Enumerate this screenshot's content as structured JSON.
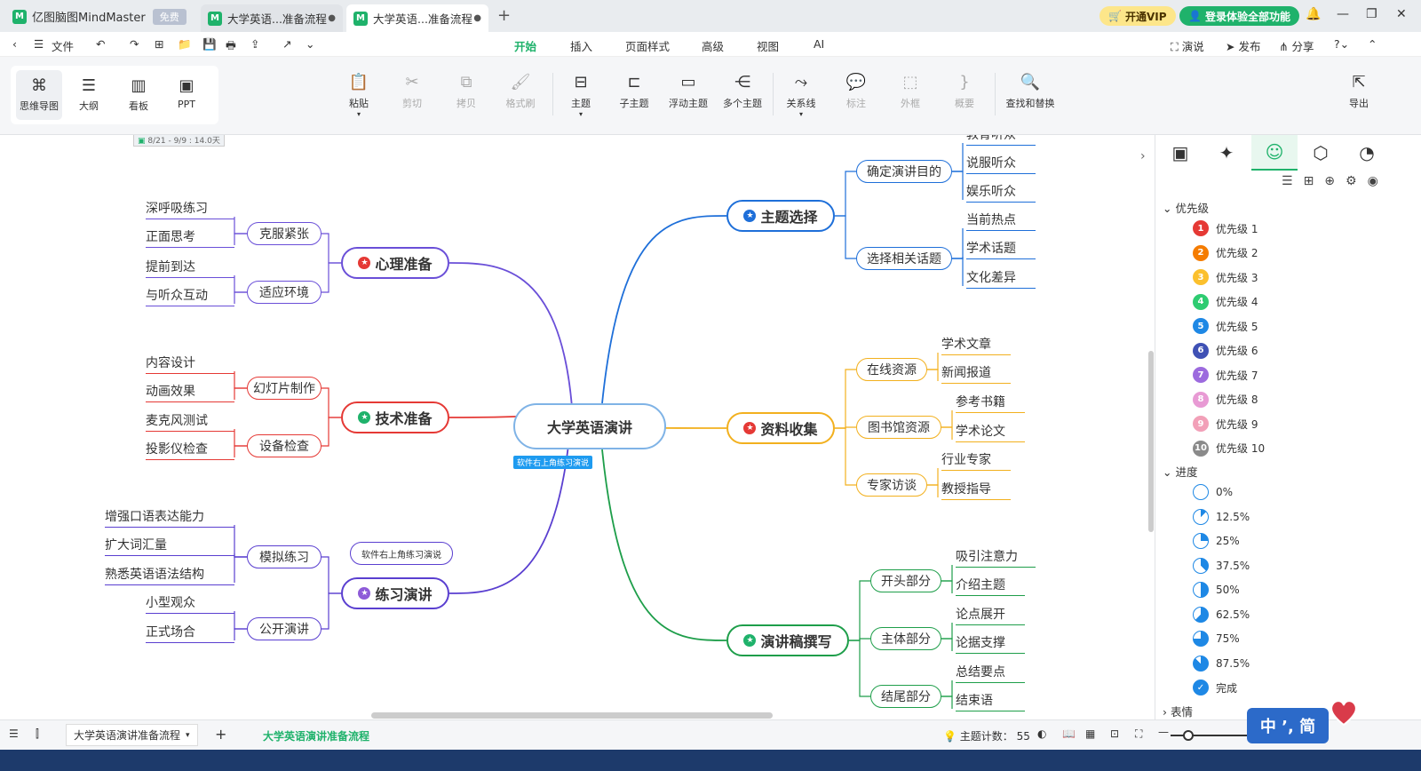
{
  "app": {
    "name": "亿图脑图MindMaster",
    "badge": "免费"
  },
  "tabs": [
    {
      "label": "大学英语...准备流程"
    },
    {
      "label": "大学英语...准备流程"
    }
  ],
  "titlebar": {
    "vip": "开通VIP",
    "login": "登录体验全部功能"
  },
  "menubar": {
    "file": "文件",
    "items": [
      "开始",
      "插入",
      "页面样式",
      "高级",
      "视图",
      "AI"
    ],
    "right": [
      "演说",
      "发布",
      "分享"
    ]
  },
  "views": [
    "思维导图",
    "大纲",
    "看板",
    "PPT"
  ],
  "ribbon": {
    "paste": "粘贴",
    "cut": "剪切",
    "copy": "拷贝",
    "format": "格式刷",
    "topic": "主题",
    "subtopic": "子主题",
    "float": "浮动主题",
    "multi": "多个主题",
    "relation": "关系线",
    "note": "标注",
    "outer": "外框",
    "summary": "概要",
    "find": "查找和替换",
    "export": "导出"
  },
  "mindmap": {
    "date_tag": "8/21 - 9/9 : 14.0天",
    "center": "大学英语演讲",
    "center_tip": "软件右上角练习演说",
    "practice_callout": "软件右上角练习演说",
    "left": [
      {
        "title": "心理准备",
        "color": "#6a4fd8",
        "mark": "#e53935",
        "subs": [
          {
            "title": "克服紧张",
            "leaves": [
              "深呼吸练习",
              "正面思考"
            ]
          },
          {
            "title": "适应环境",
            "leaves": [
              "提前到达",
              "与听众互动"
            ]
          }
        ]
      },
      {
        "title": "技术准备",
        "color": "#e53935",
        "mark": "#1fb26b",
        "subs": [
          {
            "title": "幻灯片制作",
            "leaves": [
              "内容设计",
              "动画效果"
            ]
          },
          {
            "title": "设备检查",
            "leaves": [
              "麦克风测试",
              "投影仪检查"
            ]
          }
        ]
      },
      {
        "title": "练习演讲",
        "color": "#5a3fd0",
        "mark": "#8e5bd8",
        "subs": [
          {
            "title": "模拟练习",
            "leaves": [
              "增强口语表达能力",
              "扩大词汇量",
              "熟悉英语语法结构"
            ]
          },
          {
            "title": "公开演讲",
            "leaves": [
              "小型观众",
              "正式场合"
            ]
          }
        ]
      }
    ],
    "right": [
      {
        "title": "主题选择",
        "color": "#1e6fd9",
        "mark": "#1e6fd9",
        "subs": [
          {
            "title": "确定演讲目的",
            "leaves": [
              "教育听众",
              "说服听众",
              "娱乐听众"
            ]
          },
          {
            "title": "选择相关话题",
            "leaves": [
              "当前热点",
              "学术话题",
              "文化差异"
            ]
          }
        ]
      },
      {
        "title": "资料收集",
        "color": "#f2b01e",
        "mark": "#e53935",
        "subs": [
          {
            "title": "在线资源",
            "leaves": [
              "学术文章",
              "新闻报道"
            ]
          },
          {
            "title": "图书馆资源",
            "leaves": [
              "参考书籍",
              "学术论文"
            ]
          },
          {
            "title": "专家访谈",
            "leaves": [
              "行业专家",
              "教授指导"
            ]
          }
        ]
      },
      {
        "title": "演讲稿撰写",
        "color": "#1e9e4a",
        "mark": "#1fb26b",
        "subs": [
          {
            "title": "开头部分",
            "leaves": [
              "吸引注意力",
              "介绍主题"
            ]
          },
          {
            "title": "主体部分",
            "leaves": [
              "论点展开",
              "论据支撑"
            ]
          },
          {
            "title": "结尾部分",
            "leaves": [
              "总结要点",
              "结束语"
            ]
          }
        ]
      }
    ]
  },
  "panel": {
    "priority_header": "优先级",
    "priorities": [
      {
        "n": "1",
        "label": "优先级 1",
        "color": "#e53935"
      },
      {
        "n": "2",
        "label": "优先级 2",
        "color": "#f57c00"
      },
      {
        "n": "3",
        "label": "优先级 3",
        "color": "#fbc02d"
      },
      {
        "n": "4",
        "label": "优先级 4",
        "color": "#2ecc71"
      },
      {
        "n": "5",
        "label": "优先级 5",
        "color": "#1e88e5"
      },
      {
        "n": "6",
        "label": "优先级 6",
        "color": "#3f51b5"
      },
      {
        "n": "7",
        "label": "优先级 7",
        "color": "#9c6ade"
      },
      {
        "n": "8",
        "label": "优先级 8",
        "color": "#e89ad4"
      },
      {
        "n": "9",
        "label": "优先级 9",
        "color": "#f2a0b8"
      },
      {
        "n": "10",
        "label": "优先级 10",
        "color": "#8a8a8a"
      }
    ],
    "progress_header": "进度",
    "progress": [
      {
        "label": "0%",
        "value": 0
      },
      {
        "label": "12.5%",
        "value": 0.125
      },
      {
        "label": "25%",
        "value": 0.25
      },
      {
        "label": "37.5%",
        "value": 0.375
      },
      {
        "label": "50%",
        "value": 0.5
      },
      {
        "label": "62.5%",
        "value": 0.625
      },
      {
        "label": "75%",
        "value": 0.75
      },
      {
        "label": "87.5%",
        "value": 0.875
      },
      {
        "label": "完成",
        "value": 1
      }
    ],
    "emotion_header": "表情"
  },
  "status": {
    "sheet": "大学英语演讲准备流程",
    "active_sheet": "大学英语演讲准备流程",
    "count_label": "主题计数：",
    "count": "55",
    "ime": "中 ʼ, 简"
  }
}
